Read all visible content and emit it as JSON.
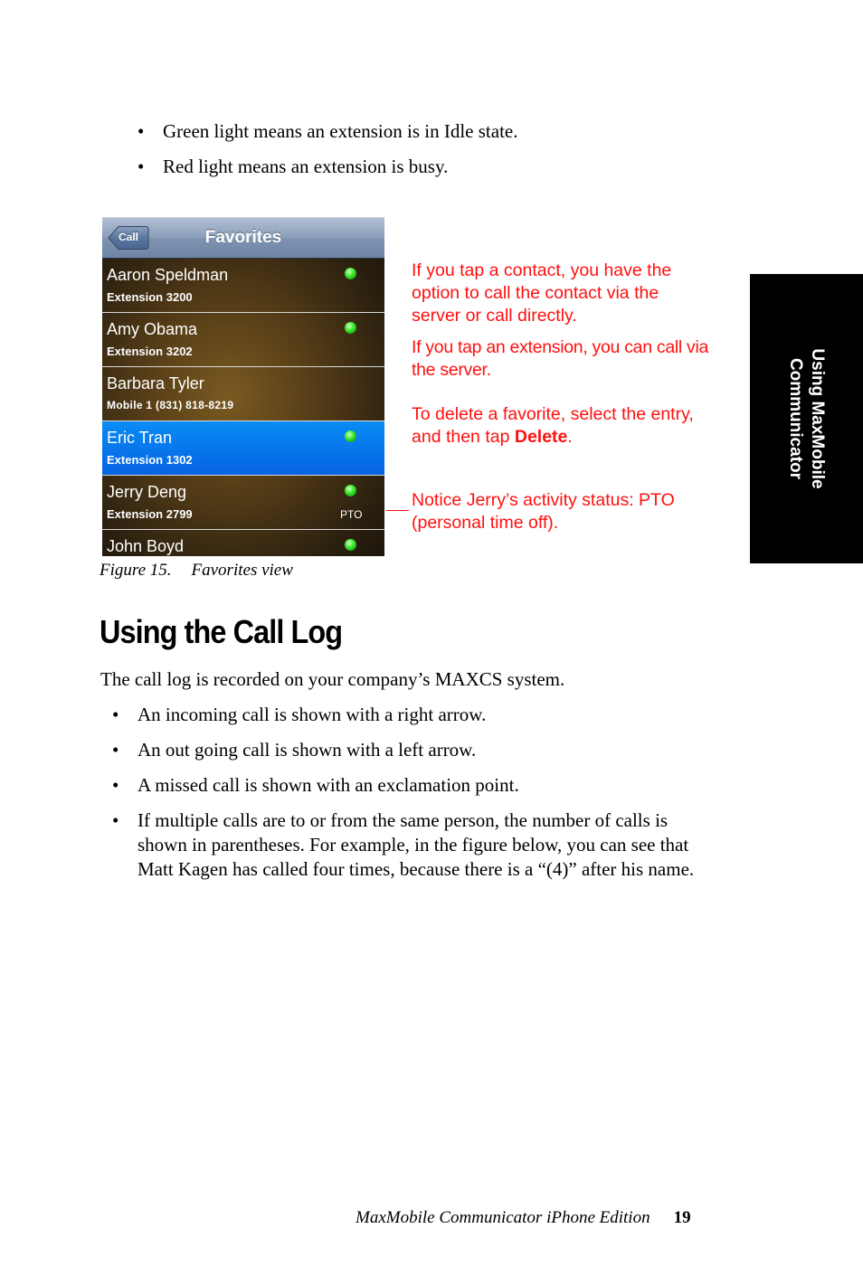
{
  "intro_bullets": [
    "Green light means an extension is in Idle state.",
    "Red light means an extension is busy."
  ],
  "bullet_glyph": "•",
  "phone": {
    "back_button": "Call",
    "title": "Favorites",
    "contacts": [
      {
        "name": "Aaron Speldman",
        "detail": "Extension 3200",
        "status_light": "green",
        "status_text": "",
        "selected": false
      },
      {
        "name": "Amy Obama",
        "detail": "Extension 3202",
        "status_light": "green",
        "status_text": "",
        "selected": false
      },
      {
        "name": "Barbara Tyler",
        "detail": "Mobile 1 (831) 818-8219",
        "status_light": "none",
        "status_text": "",
        "selected": false
      },
      {
        "name": "Eric Tran",
        "detail": "Extension 1302",
        "status_light": "green",
        "status_text": "",
        "selected": true
      },
      {
        "name": "Jerry Deng",
        "detail": "Extension 2799",
        "status_light": "green",
        "status_text": "PTO",
        "selected": false
      },
      {
        "name": "John Boyd",
        "detail": "",
        "status_light": "green",
        "status_text": "",
        "selected": false
      }
    ]
  },
  "callouts": {
    "tap_contact": "If you tap a contact, you have the option to call the contact via the server or call directly.",
    "tap_extension": "If you tap an extension, you can call via the server.",
    "delete_prefix": "To delete a favorite, select the entry, and then tap ",
    "delete_bold": "Delete",
    "delete_suffix": ".",
    "pto_note": "Notice Jerry’s activity status: PTO (personal time off)."
  },
  "figure_caption": {
    "number": "Figure 15.",
    "title": "Favorites view"
  },
  "side_tab": {
    "line1": "Using MaxMobile",
    "line2": "Communicator"
  },
  "section": {
    "heading": "Using the Call Log",
    "intro": "The call log is recorded on your company’s MAXCS system.",
    "bullets": [
      "An incoming call is shown with a right arrow.",
      "An out going call is shown with a left arrow.",
      "A missed call is shown with an exclamation point.",
      "If multiple calls are to or from the same person, the number of calls is shown in parentheses. For example, in the figure below, you can see that Matt Kagen has called four times, because there is a “(4)” after his name."
    ]
  },
  "footer": {
    "book_title": "MaxMobile Communicator iPhone Edition",
    "page_number": "19"
  },
  "colors": {
    "callout_red": "#ff1010",
    "selected_row_blue": "#0a7aee",
    "status_green": "#2fd022"
  }
}
